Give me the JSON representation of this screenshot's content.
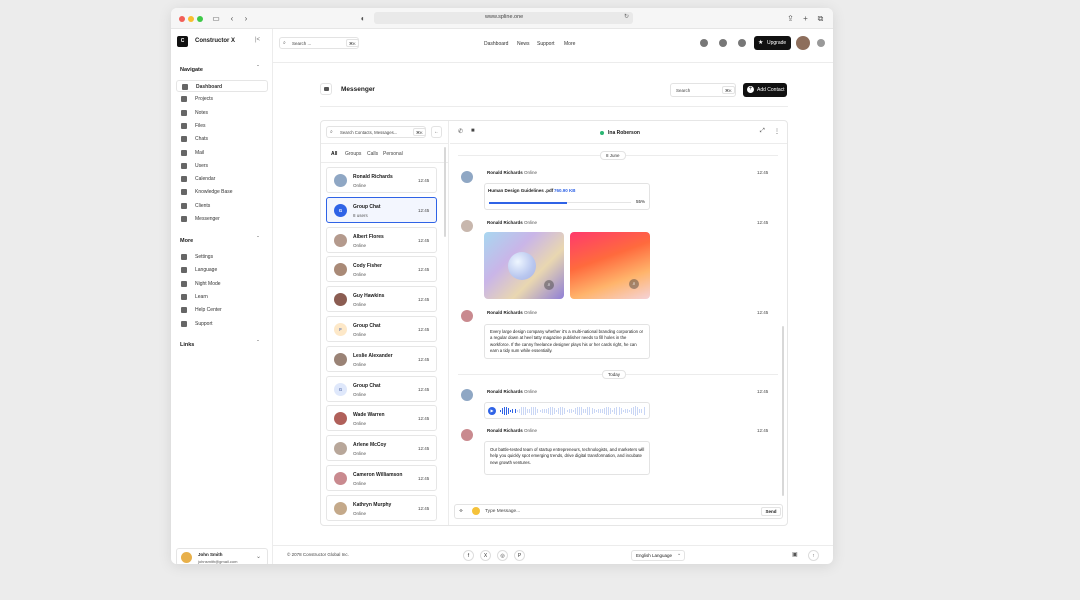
{
  "browser": {
    "url": "www.spline.one"
  },
  "sidebar": {
    "brand": "Constructor X",
    "logo_letter": "C",
    "navigate_title": "Navigate",
    "navigate_items": [
      {
        "label": "Dashboard",
        "icon": "dashboard-icon"
      },
      {
        "label": "Projects",
        "icon": "projects-icon"
      },
      {
        "label": "Notes",
        "icon": "notes-icon"
      },
      {
        "label": "Files",
        "icon": "cloud-icon"
      },
      {
        "label": "Chats",
        "icon": "chat-icon"
      },
      {
        "label": "Mail",
        "icon": "mail-icon"
      },
      {
        "label": "Users",
        "icon": "users-icon"
      },
      {
        "label": "Calendar",
        "icon": "calendar-icon"
      },
      {
        "label": "Knowledge Base",
        "icon": "knowledge-icon"
      },
      {
        "label": "Clients",
        "icon": "clients-icon"
      },
      {
        "label": "Messenger",
        "icon": "messenger-icon"
      }
    ],
    "more_title": "More",
    "more_items": [
      {
        "label": "Settings",
        "icon": "gear-icon"
      },
      {
        "label": "Language",
        "icon": "globe-icon"
      },
      {
        "label": "Night Mode",
        "icon": "moon-icon"
      },
      {
        "label": "Learn",
        "icon": "graduation-icon"
      },
      {
        "label": "Help Center",
        "icon": "help-icon"
      },
      {
        "label": "Support",
        "icon": "support-icon"
      }
    ],
    "links_title": "Links",
    "user": {
      "name": "John Smith",
      "email": "johnsmith@gmail.com"
    }
  },
  "topbar": {
    "search_placeholder": "Search ...",
    "search_kbd": "⌘K",
    "links": [
      "Dashboard",
      "News",
      "Support",
      "More"
    ],
    "upgrade_label": "Upgrade"
  },
  "main": {
    "title": "Messenger",
    "search_placeholder": "Search",
    "search_kbd": "⌘K",
    "add_contact_label": "Add Contact"
  },
  "contacts": {
    "search_placeholder": "Search Contacts, Messages...",
    "search_kbd": "⌘K",
    "tabs": [
      "All",
      "Groups",
      "Calls",
      "Personal"
    ],
    "items": [
      {
        "name": "Ronald Richards",
        "status": "Online",
        "time": "12:45",
        "avatar": "#8fa7c4"
      },
      {
        "name": "Group Chat",
        "status": "8 users",
        "time": "12:45",
        "avatar": "#2f63e6",
        "letter": "G"
      },
      {
        "name": "Albert Flores",
        "status": "Online",
        "time": "12:45",
        "avatar": "#b49a8d"
      },
      {
        "name": "Cody Fisher",
        "status": "Online",
        "time": "12:45",
        "avatar": "#a98a77"
      },
      {
        "name": "Guy Hawkins",
        "status": "Online",
        "time": "12:45",
        "avatar": "#8b5d52"
      },
      {
        "name": "Group Chat",
        "status": "Online",
        "time": "12:45",
        "avatar": "#fde8c8",
        "letter": "F"
      },
      {
        "name": "Leslie Alexander",
        "status": "Online",
        "time": "12:45",
        "avatar": "#9a8376"
      },
      {
        "name": "Group Chat",
        "status": "Online",
        "time": "12:45",
        "avatar": "#dfe8fb",
        "letter": "G"
      },
      {
        "name": "Wade Warren",
        "status": "Online",
        "time": "12:45",
        "avatar": "#b0605a"
      },
      {
        "name": "Arlene McCoy",
        "status": "Online",
        "time": "12:45",
        "avatar": "#b8a79a"
      },
      {
        "name": "Cameron Williamson",
        "status": "Online",
        "time": "12:45",
        "avatar": "#c98a8f"
      },
      {
        "name": "Kathryn Murphy",
        "status": "Online",
        "time": "12:45",
        "avatar": "#c4a98a"
      }
    ]
  },
  "chat": {
    "contact_name": "Ina Roberson",
    "date_divider": "8 June",
    "today_divider": "Today",
    "messages": [
      {
        "name": "Ronald Richards",
        "status": "Online",
        "time": "12:45"
      },
      {
        "name": "Ronald Richards",
        "status": "Online",
        "time": "12:45"
      },
      {
        "name": "Ronald Richards",
        "status": "Online",
        "time": "12:45"
      },
      {
        "name": "Ronald Richards",
        "status": "Online",
        "time": "12:45"
      },
      {
        "name": "Ronald Richards",
        "status": "Online",
        "time": "12:45"
      }
    ],
    "file": {
      "name": "Human Design Guidelines .pdf",
      "size": "760.90 KB",
      "progress": 55,
      "progress_label": "55%"
    },
    "text1": "Every large design company whether it’s a multi-national branding corporation or a regular down at heel tatty magazine publisher needs to fill holes in the workforce. If the canny freelance designer plays his or her cards right, he can earn a tidy sum while essentially.",
    "text2": "Our battle-tested team of startup entrepreneurs, technologists, and marketers will help you quickly spot emerging trends, drive digital transformation, and incubate new growth ventures.",
    "input_placeholder": "Type Message...",
    "send_label": "Send"
  },
  "footer": {
    "copyright": "© 2078 Constructor Global Inc.",
    "language": "English Language"
  }
}
